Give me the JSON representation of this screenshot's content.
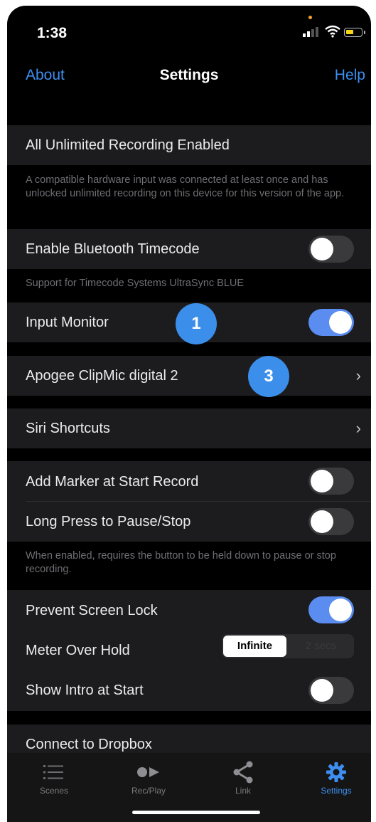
{
  "status_bar": {
    "time": "1:38"
  },
  "nav": {
    "left": "About",
    "title": "Settings",
    "right": "Help"
  },
  "sections": {
    "recording": {
      "label": "All Unlimited Recording Enabled",
      "footer": "A compatible hardware input was connected at least once and has unlocked unlimited recording on this device for this version of the app."
    },
    "bluetooth": {
      "label": "Enable Bluetooth Timecode",
      "toggle": "off",
      "footer": "Support for Timecode Systems UltraSync BLUE"
    },
    "input_monitor": {
      "label": "Input Monitor",
      "toggle": "on",
      "badge": "1"
    },
    "device": {
      "label": "Apogee ClipMic digital 2",
      "badge": "3"
    },
    "siri": {
      "label": "Siri Shortcuts"
    },
    "markers": {
      "add_marker_label": "Add Marker at Start Record",
      "add_marker_toggle": "off",
      "long_press_label": "Long Press to Pause/Stop",
      "long_press_toggle": "off",
      "footer": "When enabled, requires the button to be held down to pause or stop recording."
    },
    "display": {
      "prevent_lock_label": "Prevent Screen Lock",
      "prevent_lock_toggle": "on",
      "meter_label": "Meter Over Hold",
      "meter_options": [
        "Infinite",
        "2 secs"
      ],
      "meter_selected": "Infinite",
      "intro_label": "Show Intro at Start",
      "intro_toggle": "off"
    },
    "dropbox": {
      "label": "Connect to Dropbox"
    }
  },
  "tabbar": {
    "tabs": [
      {
        "label": "Scenes",
        "icon": "list-icon"
      },
      {
        "label": "Rec/Play",
        "icon": "record-play-icon"
      },
      {
        "label": "Link",
        "icon": "share-icon"
      },
      {
        "label": "Settings",
        "icon": "gear-icon"
      }
    ],
    "active": "Settings"
  },
  "colors": {
    "accent": "#3d8ef0",
    "toggle_on": "#5b8cf0",
    "badge": "#3b8eea",
    "cell_bg": "#1c1c1e",
    "background": "#000000"
  }
}
